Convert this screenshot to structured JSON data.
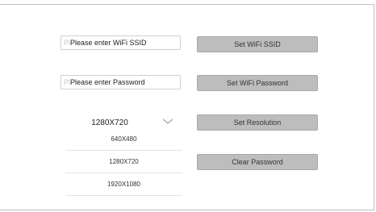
{
  "wifi": {
    "ssid_prefix": "Pl",
    "ssid_value": "Please enter WiFi SSID",
    "password_prefix": "Pl",
    "password_value": "Please enter Password"
  },
  "buttons": {
    "set_ssid": "Set WiFi SSID",
    "set_password": "Set WiFi Password",
    "set_resolution": "Set Resolution",
    "clear_password": "Clear Password"
  },
  "resolution": {
    "selected": "1280X720",
    "options": [
      "640X480",
      "1280X720",
      "1920X1080"
    ],
    "icon": "chevron-down-icon"
  }
}
